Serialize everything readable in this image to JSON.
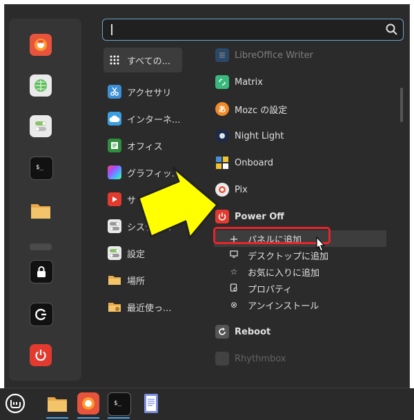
{
  "search": {
    "placeholder": ""
  },
  "categories": [
    {
      "label": "すべての...",
      "icon": "grid-icon",
      "active": true
    },
    {
      "label": "アクセサリ",
      "icon": "scissors-icon"
    },
    {
      "label": "インターネ...",
      "icon": "cloud-icon"
    },
    {
      "label": "オフィス",
      "icon": "office-icon"
    },
    {
      "label": "グラフィッ...",
      "icon": "graphics-icon"
    },
    {
      "label": "サ",
      "icon": "play-icon"
    },
    {
      "label": "システム...",
      "icon": "toggle-icon"
    },
    {
      "label": "設定",
      "icon": "settings-toggle-icon"
    },
    {
      "label": "場所",
      "icon": "folder-icon"
    },
    {
      "label": "最近使っ...",
      "icon": "recent-folder-icon"
    }
  ],
  "apps": [
    {
      "label": "LibreOffice Writer",
      "icon": "writer-icon",
      "dim": true
    },
    {
      "label": "Matrix",
      "icon": "matrix-icon"
    },
    {
      "label": "Mozc の設定",
      "icon": "mozc-icon"
    },
    {
      "label": "Night Light",
      "icon": "moon-icon"
    },
    {
      "label": "Onboard",
      "icon": "onboard-icon"
    },
    {
      "label": "Pix",
      "icon": "pix-icon"
    },
    {
      "label": "Power Off",
      "icon": "power-icon",
      "bold": true
    },
    {
      "label": "Reboot",
      "icon": "reboot-icon",
      "bold": true
    },
    {
      "label": "Rhythmbox",
      "icon": "rhythmbox-icon",
      "dim": true
    }
  ],
  "context_menu": [
    {
      "label": "パネルに追加",
      "icon": "plus-icon"
    },
    {
      "label": "デスクトップに追加",
      "icon": "desktop-icon"
    },
    {
      "label": "お気に入りに追加",
      "icon": "star-icon"
    },
    {
      "label": "プロパティ",
      "icon": "properties-icon"
    },
    {
      "label": "アンインストール",
      "icon": "uninstall-icon"
    }
  ],
  "colors": {
    "accent": "#4aa3e8",
    "highlight_box": "#e8242a",
    "arrow": "#ffff00"
  }
}
